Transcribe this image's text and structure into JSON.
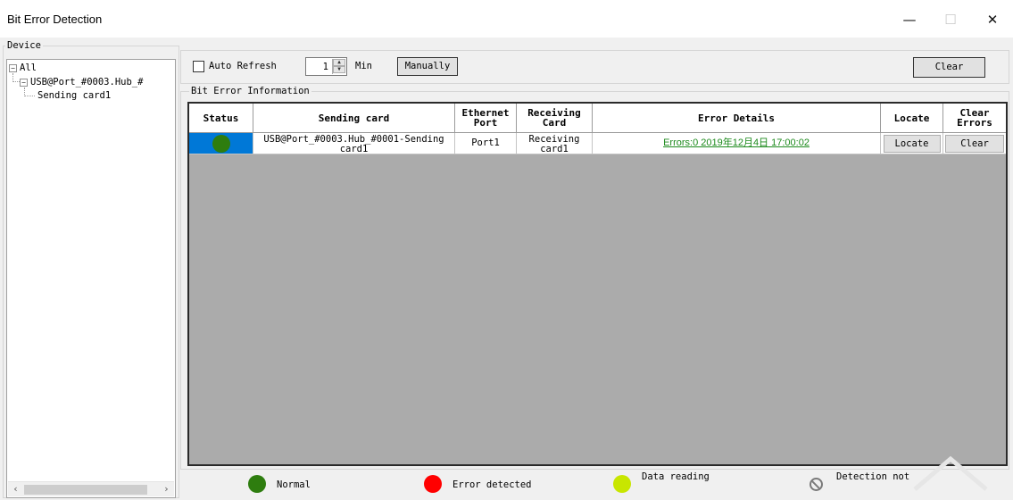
{
  "window": {
    "title": "Bit Error Detection",
    "minimize_glyph": "—",
    "maximize_glyph": "☐",
    "close_glyph": "✕"
  },
  "device": {
    "group_label": "Device",
    "tree": {
      "root": {
        "label": "All",
        "expander": "−"
      },
      "child": {
        "label": "USB@Port_#0003.Hub_#",
        "expander": "−"
      },
      "leaf": {
        "label": "Sending card1"
      }
    },
    "scroll_left": "‹",
    "scroll_right": "›"
  },
  "toolbar": {
    "auto_refresh_label": "Auto Refresh",
    "auto_refresh_checked": false,
    "interval_value": "1",
    "interval_unit": "Min",
    "manually_label": "Manually",
    "clear_label": "Clear"
  },
  "bit_error": {
    "group_label": "Bit Error Information",
    "columns": {
      "status": "Status",
      "sending_card": "Sending card",
      "ethernet_port_1": "Ethernet",
      "ethernet_port_2": "Port",
      "receiving_card_1": "Receiving",
      "receiving_card_2": "Card",
      "error_details": "Error Details",
      "locate": "Locate",
      "clear_errors_1": "Clear",
      "clear_errors_2": "Errors"
    },
    "rows": [
      {
        "status": "normal",
        "status_color": "#2e7d0f",
        "sending_card_1": "USB@Port_#0003.Hub_#0001-Sending",
        "sending_card_2": "card1",
        "ethernet_port": "Port1",
        "receiving_card_1": "Receiving",
        "receiving_card_2": "card1",
        "error_details": "Errors:0  2019年12月4日 17:00:02",
        "locate_label": "Locate",
        "clear_label": "Clear"
      }
    ]
  },
  "legend": {
    "normal": {
      "label": "Normal",
      "color": "#2e7d0f"
    },
    "error": {
      "label": "Error detected",
      "color": "#ff0000"
    },
    "reading": {
      "label": "Data reading",
      "color": "#c8e600"
    },
    "not_detected": {
      "label": "Detection not",
      "icon": "prohibited-icon"
    }
  },
  "colors": {
    "accent_selection": "#0078d7",
    "grid_background": "#ababab",
    "link_green": "#1c8a1c"
  }
}
